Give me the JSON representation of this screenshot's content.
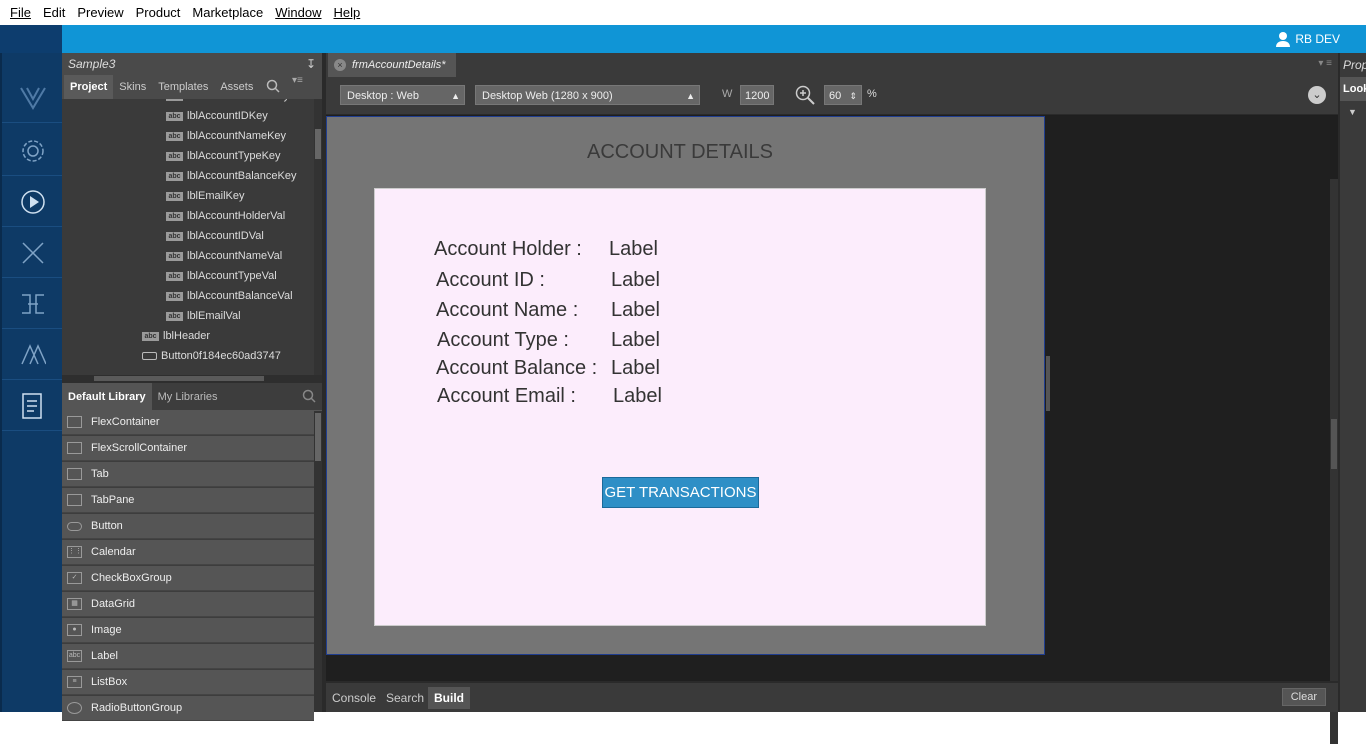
{
  "menu": [
    {
      "id": "file",
      "label": "File"
    },
    {
      "id": "edit",
      "label": "Edit"
    },
    {
      "id": "preview",
      "label": "Preview"
    },
    {
      "id": "product",
      "label": "Product"
    },
    {
      "id": "marketplace",
      "label": "Marketplace"
    },
    {
      "id": "window",
      "label": "Window"
    },
    {
      "id": "help",
      "label": "Help"
    }
  ],
  "user": {
    "name": "RB DEV",
    "icon": "user-icon"
  },
  "left_rail": {
    "icons": [
      "logo-icon",
      "settings-icon",
      "play-icon",
      "tools-icon",
      "services-icon",
      "design-icon",
      "document-icon"
    ]
  },
  "project_panel": {
    "title": "Sample3",
    "tabs": [
      "Project",
      "Skins",
      "Templates",
      "Assets"
    ],
    "active_tab": "Project",
    "tree": [
      {
        "label": "lblAccountHolderKey",
        "icon": "abc"
      },
      {
        "label": "lblAccountIDKey",
        "icon": "abc"
      },
      {
        "label": "lblAccountNameKey",
        "icon": "abc"
      },
      {
        "label": "lblAccountTypeKey",
        "icon": "abc"
      },
      {
        "label": "lblAccountBalanceKey",
        "icon": "abc"
      },
      {
        "label": "lblEmailKey",
        "icon": "abc"
      },
      {
        "label": "lblAccountHolderVal",
        "icon": "abc"
      },
      {
        "label": "lblAccountIDVal",
        "icon": "abc"
      },
      {
        "label": "lblAccountNameVal",
        "icon": "abc"
      },
      {
        "label": "lblAccountTypeVal",
        "icon": "abc"
      },
      {
        "label": "lblAccountBalanceVal",
        "icon": "abc"
      },
      {
        "label": "lblEmailVal",
        "icon": "abc"
      },
      {
        "label": "lblHeader",
        "icon": "abc"
      },
      {
        "label": "Button0f184ec60ad3747",
        "icon": "button"
      }
    ]
  },
  "library_panel": {
    "tabs": [
      "Default Library",
      "My Libraries"
    ],
    "active_tab": "Default Library",
    "items": [
      "FlexContainer",
      "FlexScrollContainer",
      "Tab",
      "TabPane",
      "Button",
      "Calendar",
      "CheckBoxGroup",
      "DataGrid",
      "Image",
      "Label",
      "ListBox",
      "RadioButtonGroup"
    ]
  },
  "editor": {
    "tab_label": "frmAccountDetails*",
    "platform": "Desktop : Web",
    "resolution": "Desktop Web (1280 x 900)",
    "width_label": "W",
    "width_value": "1200",
    "zoom_value": "60",
    "zoom_unit": "%"
  },
  "form": {
    "title": "ACCOUNT DETAILS",
    "rows": [
      {
        "key": "Account Holder :",
        "value": "Label"
      },
      {
        "key": "Account ID :",
        "value": "Label"
      },
      {
        "key": "Account Name :",
        "value": "Label"
      },
      {
        "key": "Account Type :",
        "value": "Label"
      },
      {
        "key": "Account Balance :",
        "value": "Label"
      },
      {
        "key": "Account Email :",
        "value": "Label"
      }
    ],
    "button": "GET TRANSACTIONS"
  },
  "bottom_panel": {
    "tabs": [
      "Console",
      "Search",
      "Build"
    ],
    "active_tab": "Build",
    "clear": "Clear"
  },
  "properties_panel": {
    "title": "Properties",
    "tab": "Look"
  }
}
